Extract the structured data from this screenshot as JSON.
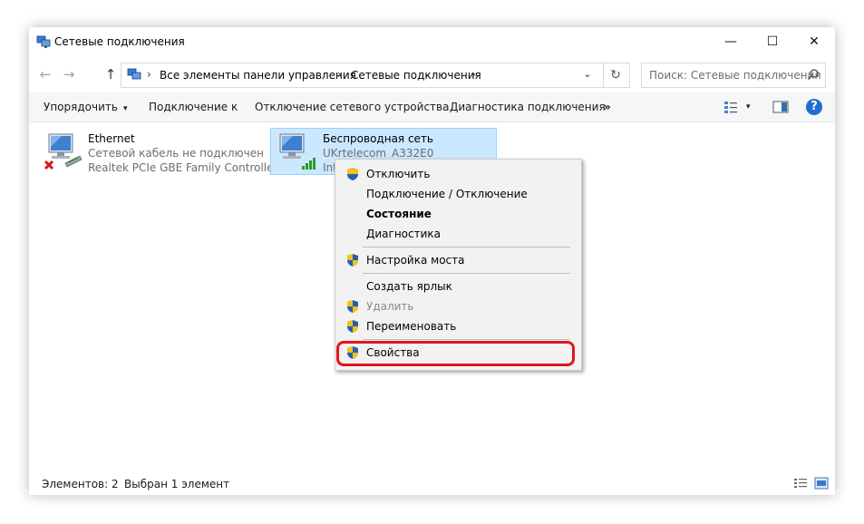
{
  "window": {
    "title": "Сетевые подключения",
    "controls": {
      "minimize": "—",
      "maximize": "☐",
      "close": "✕"
    }
  },
  "nav": {
    "back": "←",
    "forward": "→",
    "up": "↑"
  },
  "address": {
    "crumbs": [
      "Все элементы панели управления",
      "Сетевые подключения"
    ],
    "separator": "›",
    "dropdown": "⌄",
    "refresh": "↻"
  },
  "search": {
    "placeholder": "Поиск: Сетевые подключения"
  },
  "toolbar": {
    "organize": "Упорядочить",
    "organize_caret": "▾",
    "connect_to": "Подключение к",
    "disable_device": "Отключение сетевого устройства",
    "diagnose": "Диагностика подключения",
    "more": "»",
    "view_caret": "▾",
    "help": "?"
  },
  "connections": [
    {
      "name": "Ethernet",
      "status": "Сетевой кабель не подключен",
      "device": "Realtek PCIe GBE Family Controller",
      "disconnected": true
    },
    {
      "name": "Беспроводная сеть",
      "status": "UKrtelecom_A332E0",
      "device": "Int",
      "selected": true
    }
  ],
  "context_menu": {
    "items": [
      {
        "label": "Отключить",
        "shield": true
      },
      {
        "label": "Подключение / Отключение",
        "shield": false
      },
      {
        "label": "Состояние",
        "shield": false,
        "bold": true
      },
      {
        "label": "Диагностика",
        "shield": false
      },
      {
        "label": "Настройка моста",
        "shield": true
      },
      {
        "label": "Создать ярлык",
        "shield": false
      },
      {
        "label": "Удалить",
        "shield": true,
        "disabled": true
      },
      {
        "label": "Переименовать",
        "shield": true
      },
      {
        "label": "Свойства",
        "shield": true,
        "highlighted": true
      }
    ]
  },
  "statusbar": {
    "items_count": "Элементов: 2",
    "selected": "Выбран 1 элемент"
  },
  "colors": {
    "selection": "#cce8ff",
    "highlight_ring": "#e2161c",
    "help": "#1f6fd1"
  }
}
